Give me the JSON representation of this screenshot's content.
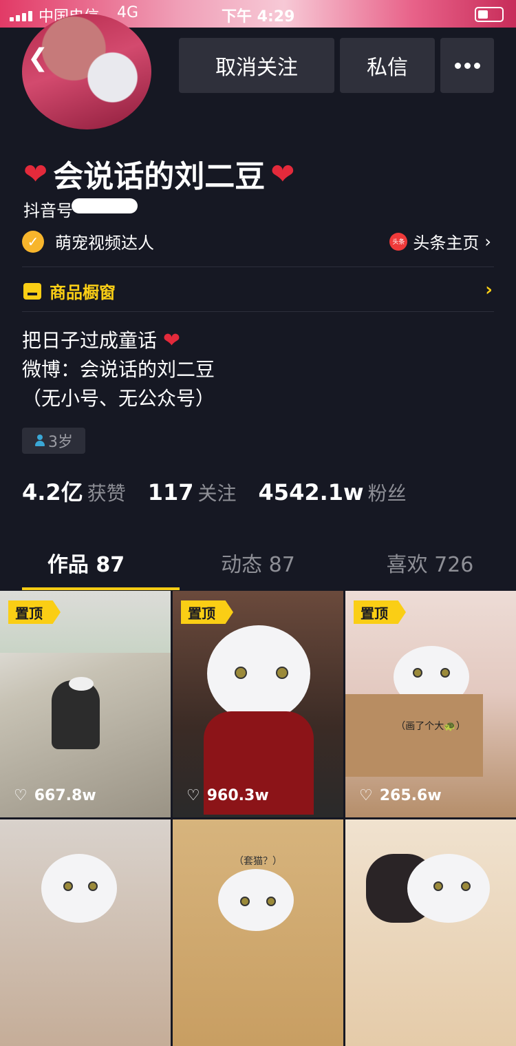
{
  "status_bar": {
    "carrier": "中国电信",
    "network": "4G",
    "time": "下午 4:29"
  },
  "header": {
    "unfollow_label": "取消关注",
    "message_label": "私信",
    "more_label": "•••"
  },
  "profile": {
    "name": "会说话的刘二豆",
    "douyin_id_label": "抖音号",
    "verified_label": "萌宠视频达人",
    "toutiao_badge": "头条",
    "toutiao_label": "头条主页",
    "shop_label": "商品橱窗",
    "bio_lines": [
      "把日子过成童话",
      "微博：会说话的刘二豆",
      "（无小号、无公众号）"
    ],
    "age": "3岁"
  },
  "stats": [
    {
      "value": "4.2亿",
      "label": "获赞"
    },
    {
      "value": "117",
      "label": "关注"
    },
    {
      "value": "4542.1w",
      "label": "粉丝"
    }
  ],
  "tabs": [
    {
      "label": "作品 87"
    },
    {
      "label": "动态 87"
    },
    {
      "label": "喜欢 726"
    }
  ],
  "videos": [
    {
      "pinned_label": "置顶",
      "likes": "667.8w",
      "caption": ""
    },
    {
      "pinned_label": "置顶",
      "likes": "960.3w",
      "caption": ""
    },
    {
      "pinned_label": "置顶",
      "likes": "265.6w",
      "caption": "（画了个大🐢）"
    },
    {
      "pinned_label": "",
      "likes": "",
      "caption": ""
    },
    {
      "pinned_label": "",
      "likes": "",
      "caption": "（套猫？）"
    },
    {
      "pinned_label": "",
      "likes": "",
      "caption": ""
    }
  ],
  "colors": {
    "background": "#161823",
    "accent": "#face15",
    "heart": "#e32a3b"
  }
}
